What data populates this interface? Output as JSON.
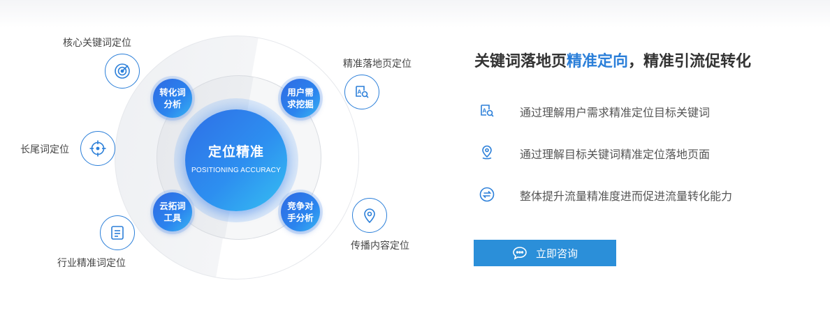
{
  "diagram": {
    "core_title": "定位精准",
    "core_subtitle": "POSITIONING ACCURACY",
    "inner_nodes": [
      {
        "label": "转化词分析"
      },
      {
        "label": "用户需求挖掘"
      },
      {
        "label": "云拓词工具"
      },
      {
        "label": "竞争对手分析"
      }
    ],
    "outer_items": [
      {
        "label": "核心关键词定位",
        "icon": "target-icon"
      },
      {
        "label": "精准落地页定位",
        "icon": "search-page-icon"
      },
      {
        "label": "长尾词定位",
        "icon": "crosshair-icon"
      },
      {
        "label": "行业精准词定位",
        "icon": "document-icon"
      },
      {
        "label": "传播内容定位",
        "icon": "location-pin-icon"
      }
    ]
  },
  "panel": {
    "heading_pre": "关键词落地页",
    "heading_highlight": "精准定向",
    "heading_post": "，精准引流促转化",
    "features": [
      {
        "text": "通过理解用户需求精准定位目标关键词",
        "icon": "search-page-icon"
      },
      {
        "text": "通过理解目标关键词精准定位落地页面",
        "icon": "location-pin-icon"
      },
      {
        "text": "整体提升流量精准度进而促进流量转化能力",
        "icon": "exchange-icon"
      }
    ],
    "cta_label": "立即咨询",
    "cta_icon": "chat-bubble-icon"
  },
  "colors": {
    "accent": "#2b7fd9",
    "button": "#2b8fd9",
    "core_gradient_start": "#2f6fe6",
    "core_gradient_end": "#36c0f2"
  }
}
